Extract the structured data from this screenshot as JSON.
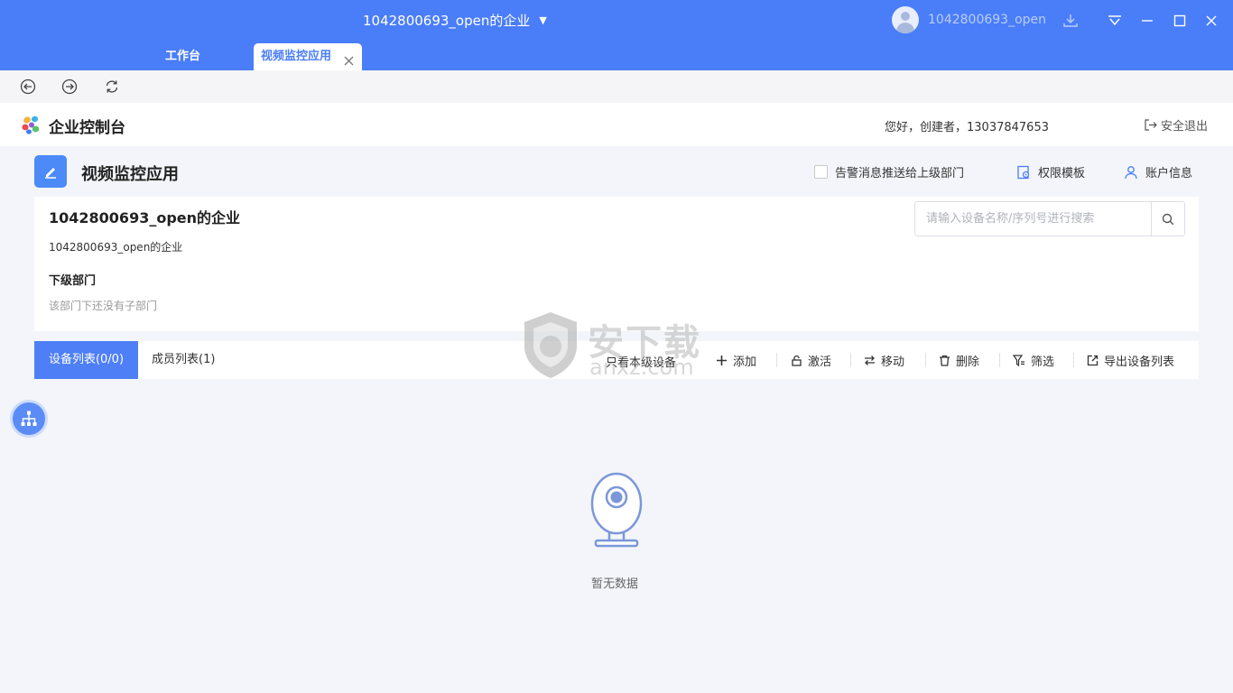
{
  "window": {
    "title": "1042800693_open的企业",
    "user_name": "1042800693_open"
  },
  "tabs": [
    {
      "label": "工作台"
    },
    {
      "label": "视频监控应用"
    }
  ],
  "header": {
    "brand": "企业控制台",
    "greeting": "您好，创建者，13037847653",
    "logout": "安全退出"
  },
  "app": {
    "title": "视频监控应用",
    "alarm_push_label": "告警消息推送给上级部门",
    "permission_template": "权限模板",
    "account_info": "账户信息"
  },
  "dept": {
    "title": "1042800693_open的企业",
    "path": "1042800693_open的企业",
    "sub_heading": "下级部门",
    "sub_empty": "该部门下还没有子部门"
  },
  "search": {
    "placeholder": "请输入设备名称/序列号进行搜索"
  },
  "toolbar": {
    "device_tab": "设备列表(0/0)",
    "member_tab": "成员列表(1)",
    "only_own": "只看本级设备",
    "add": "添加",
    "activate": "激活",
    "move": "移动",
    "delete": "删除",
    "filter": "筛选",
    "export": "导出设备列表"
  },
  "empty": {
    "text": "暂无数据"
  },
  "watermark": {
    "text_big": "安下载",
    "text_small": "anxz.com"
  },
  "colors": {
    "titlebar": "#4a7df8",
    "accent": "#4e7ff6"
  }
}
